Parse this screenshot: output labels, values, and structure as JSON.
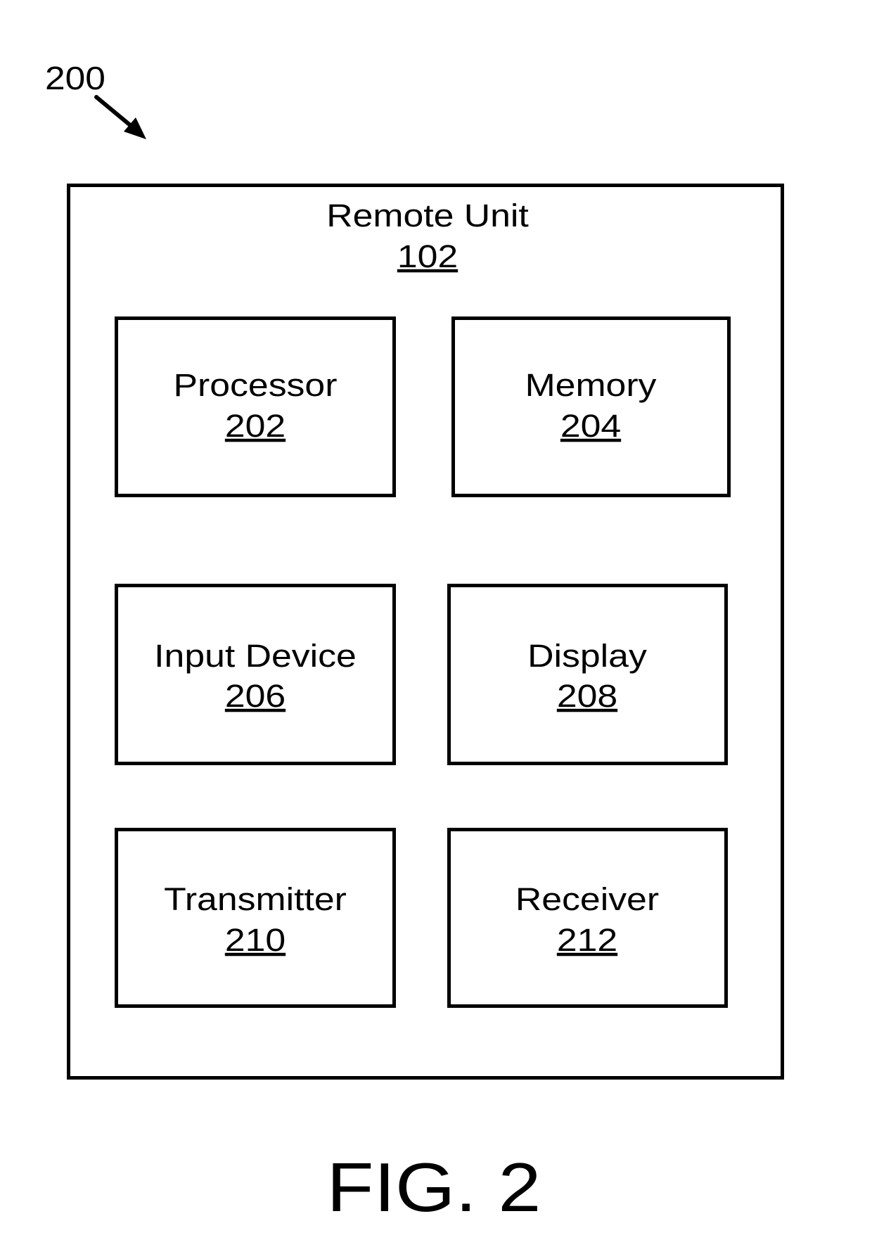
{
  "figure": {
    "reference_numeral": "200",
    "caption": "FIG. 2"
  },
  "container": {
    "title": "Remote Unit",
    "number": "102"
  },
  "components": [
    {
      "id": "processor",
      "label": "Processor",
      "number": "202"
    },
    {
      "id": "memory",
      "label": "Memory",
      "number": "204"
    },
    {
      "id": "input-device",
      "label": "Input Device",
      "number": "206"
    },
    {
      "id": "display",
      "label": "Display",
      "number": "208"
    },
    {
      "id": "transmitter",
      "label": "Transmitter",
      "number": "210"
    },
    {
      "id": "receiver",
      "label": "Receiver",
      "number": "212"
    }
  ],
  "colors": {
    "stroke": "#000000",
    "background": "#ffffff"
  }
}
